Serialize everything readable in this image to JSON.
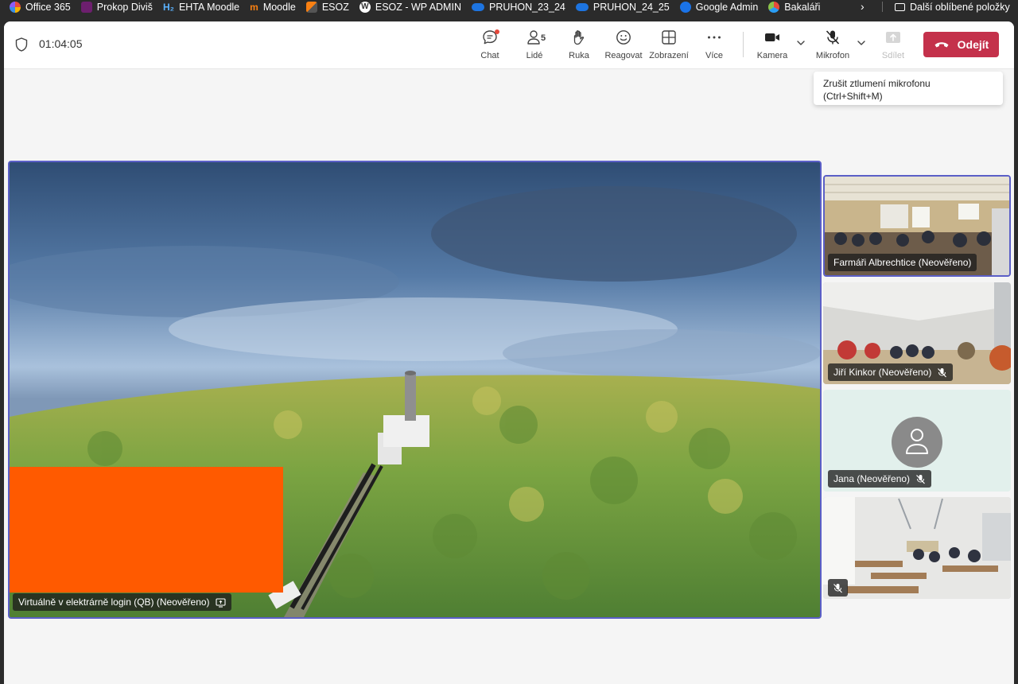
{
  "bookmarks": {
    "items": [
      {
        "label": "Office 365",
        "icon": "office365-icon"
      },
      {
        "label": "Prokop Diviš",
        "icon": "prokop-icon"
      },
      {
        "label": "EHTA Moodle",
        "icon": "h2-icon"
      },
      {
        "label": "Moodle",
        "icon": "moodle-icon"
      },
      {
        "label": "ESOZ",
        "icon": "esoz-icon"
      },
      {
        "label": "ESOZ - WP ADMIN",
        "icon": "wordpress-icon"
      },
      {
        "label": "PRUHON_23_24",
        "icon": "onedrive-icon"
      },
      {
        "label": "PRUHON_24_25",
        "icon": "onedrive-icon"
      },
      {
        "label": "Google Admin",
        "icon": "google-admin-icon"
      },
      {
        "label": "Bakaláři",
        "icon": "bakalari-icon"
      }
    ],
    "h2_glyph": "H₂",
    "moodle_glyph": "m",
    "wp_glyph": "W",
    "more_glyph": "›",
    "folder_label": "Další oblíbené položky"
  },
  "meeting": {
    "timer": "01:04:05",
    "toolbar": {
      "chat": "Chat",
      "people": "Lidé",
      "people_count": "5",
      "hand": "Ruka",
      "react": "Reagovat",
      "view": "Zobrazení",
      "more": "Více",
      "camera": "Kamera",
      "mic": "Mikrofon",
      "share": "Sdílet",
      "leave": "Odejít"
    },
    "tooltip": {
      "line1": "Zrušit ztlumení mikrofonu",
      "line2": "(Ctrl+Shift+M)"
    },
    "main_video": {
      "name": "Virtuálně v elektrárně login (QB) (Neověřeno)"
    },
    "participants": [
      {
        "name": "Farmáři Albrechtice (Neověřeno)",
        "muted": false,
        "active": true
      },
      {
        "name": "Jiří Kinkor (Neověřeno)",
        "muted": true,
        "active": false
      },
      {
        "name": "Jana (Neověřeno)",
        "muted": true,
        "active": false
      },
      {
        "name": "",
        "muted": true,
        "active": false
      }
    ],
    "colors": {
      "accent": "#5b5fc7",
      "leave": "#c4314b",
      "redaction": "#ff5a00"
    }
  }
}
